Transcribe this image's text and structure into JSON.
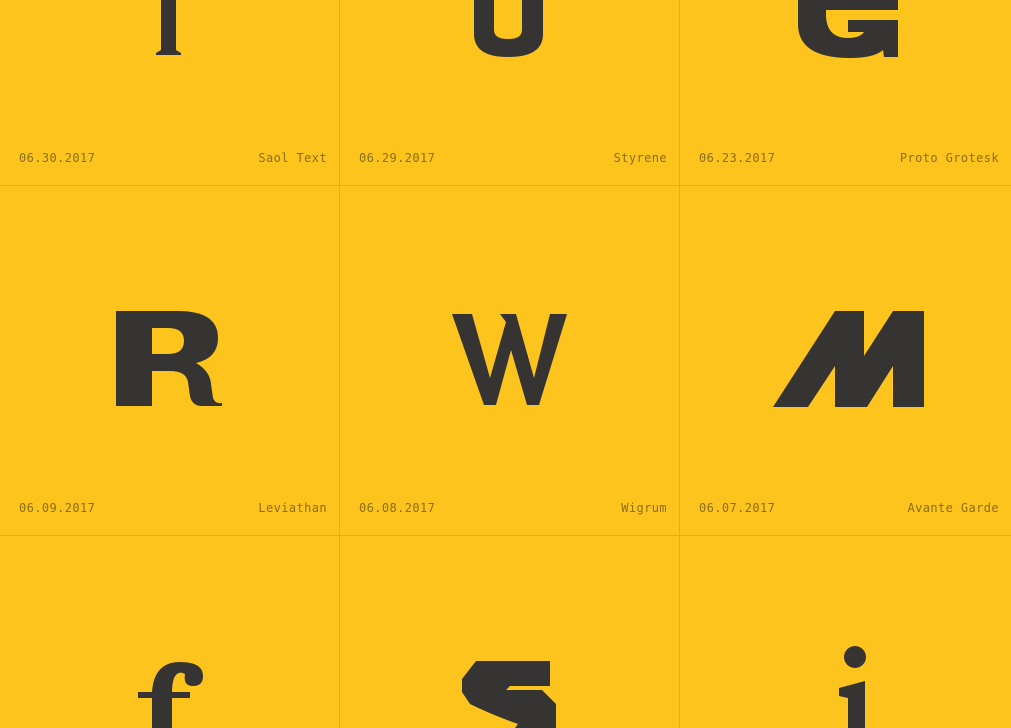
{
  "colors": {
    "background": "#fcc41c",
    "glyph": "#363432",
    "meta_text": "#8a6e1a",
    "divider": "#e3ae17"
  },
  "cards": [
    {
      "glyph": "l",
      "date": "06.30.2017",
      "font": "Saol Text"
    },
    {
      "glyph": "U",
      "date": "06.29.2017",
      "font": "Styrene"
    },
    {
      "glyph": "G",
      "date": "06.23.2017",
      "font": "Proto Grotesk"
    },
    {
      "glyph": "R",
      "date": "06.09.2017",
      "font": "Leviathan"
    },
    {
      "glyph": "W",
      "date": "06.08.2017",
      "font": "Wigrum"
    },
    {
      "glyph": "M",
      "date": "06.07.2017",
      "font": "Avante Garde"
    },
    {
      "glyph": "f",
      "date": "",
      "font": ""
    },
    {
      "glyph": "S",
      "date": "",
      "font": ""
    },
    {
      "glyph": "i",
      "date": "",
      "font": ""
    }
  ]
}
